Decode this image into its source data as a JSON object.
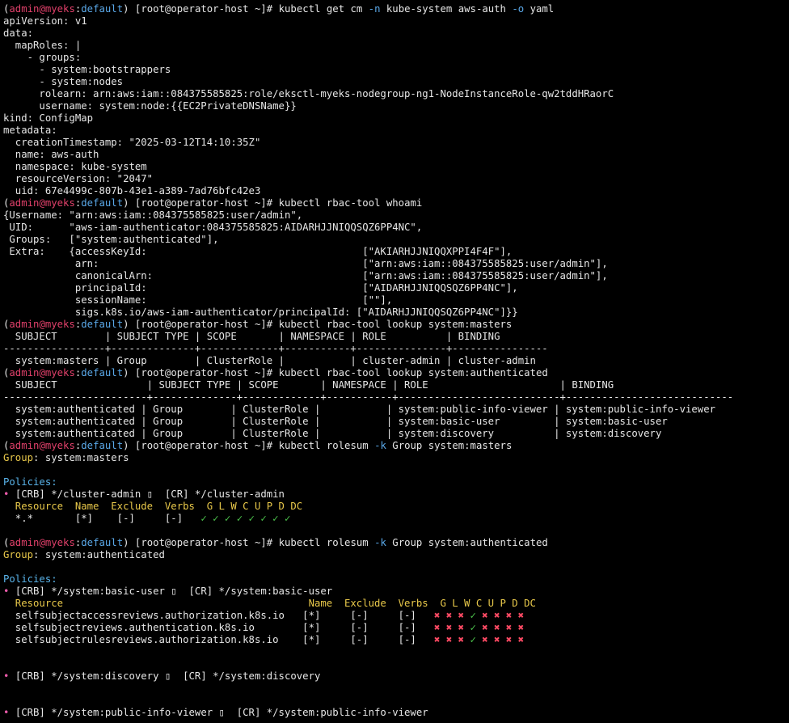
{
  "colors": {
    "background": "#000000",
    "text": "#e6e6e6",
    "prompt_user": "#e0406a",
    "prompt_context": "#5aa8e8",
    "flag": "#5aa8e8",
    "key_label": "#e8c84a",
    "section_title": "#5ab4ea",
    "bullet": "#e85aa8",
    "check": "#4ec94e",
    "cross": "#ff4a64"
  },
  "lines": [
    [
      [
        "p",
        ""
      ]
    ],
    [
      [
        "",
        "apiVersion: v1"
      ]
    ],
    [
      [
        "",
        "data:"
      ]
    ],
    [
      [
        "",
        "  mapRoles: |"
      ]
    ],
    [
      [
        "",
        "    - groups:"
      ]
    ],
    [
      [
        "",
        "      - system:bootstrappers"
      ]
    ],
    [
      [
        "",
        "      - system:nodes"
      ]
    ],
    [
      [
        "",
        "      rolearn: arn:aws:iam::084375585825:role/eksctl-myeks-nodegroup-ng1-NodeInstanceRole-qw2tddHRaorC"
      ]
    ],
    [
      [
        "",
        "      username: system:node:{{EC2PrivateDNSName}}"
      ]
    ],
    [
      [
        "",
        "kind: ConfigMap"
      ]
    ],
    [
      [
        "",
        "metadata:"
      ]
    ],
    [
      [
        "",
        "  creationTimestamp: \"2025-03-12T14:10:35Z\""
      ]
    ],
    [
      [
        "",
        "  name: aws-auth"
      ]
    ],
    [
      [
        "",
        "  namespace: kube-system"
      ]
    ],
    [
      [
        "",
        "  resourceVersion: \"2047\""
      ]
    ],
    [
      [
        "",
        "  uid: 67e4499c-807b-43e1-a389-7ad76bfc42e3"
      ]
    ],
    [
      [
        "p",
        ""
      ]
    ],
    [
      [
        "",
        "{Username: \"arn:aws:iam::084375585825:user/admin\","
      ]
    ],
    [
      [
        "",
        "",
        " UID:      \"aws-iam-authenticator:084375585825:AIDARHJJNIQQSQZ6PP4NC\","
      ]
    ],
    [
      [
        "",
        "",
        " Groups:   [\"system:authenticated\"],"
      ]
    ],
    [
      [
        "",
        "",
        " Extra:    {accessKeyId:                                    [\"AKIARHJJNIQQXPPI4F4F\"],"
      ]
    ],
    [
      [
        "",
        "            arn:                                            [\"arn:aws:iam::084375585825:user/admin\"],"
      ]
    ],
    [
      [
        "",
        "            canonicalArn:                                   [\"arn:aws:iam::084375585825:user/admin\"],"
      ]
    ],
    [
      [
        "",
        "            principalId:                                    [\"AIDARHJJNIQQSQZ6PP4NC\"],"
      ]
    ],
    [
      [
        "",
        "            sessionName:                                    [\"\"],"
      ]
    ],
    [
      [
        "",
        "            sigs.k8s.io/aws-iam-authenticator/principalId: [\"AIDARHJJNIQQSQZ6PP4NC\"]}}"
      ]
    ],
    [
      [
        "p",
        ""
      ]
    ],
    [
      [
        "",
        "  SUBJECT        | SUBJECT TYPE | SCOPE       | NAMESPACE | ROLE          | BINDING"
      ]
    ],
    [
      [
        "",
        "-----------------+--------------+-------------+-----------+---------------+----------------"
      ]
    ],
    [
      [
        "",
        "  system:masters | Group        | ClusterRole |           | cluster-admin | cluster-admin"
      ]
    ],
    [
      [
        "p",
        ""
      ]
    ],
    [
      [
        "",
        "  SUBJECT               | SUBJECT TYPE | SCOPE       | NAMESPACE | ROLE                      | BINDING"
      ]
    ],
    [
      [
        "",
        "------------------------+--------------+-------------+-----------+---------------------------+----------------------------"
      ]
    ],
    [
      [
        "",
        "  system:authenticated | Group        | ClusterRole |           | system:public-info-viewer | system:public-info-viewer"
      ]
    ],
    [
      [
        "",
        "  system:authenticated | Group        | ClusterRole |           | system:basic-user         | system:basic-user"
      ]
    ],
    [
      [
        "",
        "  system:authenticated | Group        | ClusterRole |           | system:discovery          | system:discovery"
      ]
    ],
    [
      [
        "p",
        ""
      ]
    ],
    [
      [
        "k",
        "Group"
      ],
      [
        "",
        ": system:masters"
      ]
    ],
    [
      [
        "",
        ""
      ]
    ],
    [
      [
        "t",
        "Policies:"
      ]
    ],
    [
      [
        "b",
        "• "
      ],
      [
        "",
        "[CRB] */cluster-admin ▯  [CR] */cluster-admin"
      ]
    ],
    [
      [
        "k",
        "  Resource  Name  Exclude  Verbs  G L W C U P D DC"
      ]
    ],
    [
      [
        "",
        "  *.*       [*]    [-]     [-]   "
      ],
      [
        "g",
        "✓ ✓ ✓ ✓ ✓ ✓ ✓ ✓"
      ]
    ],
    [
      [
        "",
        ""
      ]
    ],
    [
      [
        "p",
        ""
      ]
    ],
    [
      [
        "k",
        "Group"
      ],
      [
        "",
        ": system:authenticated"
      ]
    ],
    [
      [
        "",
        ""
      ]
    ],
    [
      [
        "t",
        "Policies:"
      ]
    ],
    [
      [
        "b",
        "• "
      ],
      [
        "",
        "[CRB] */system:basic-user ▯  [CR] */system:basic-user"
      ]
    ],
    [
      [
        "k",
        "  Resource                                         Name  Exclude  Verbs  G L W C U P D DC"
      ]
    ],
    [
      [
        "",
        "  selfsubjectaccessreviews.authorization.k8s.io   [*]     [-]     [-]   "
      ],
      [
        "r",
        "✖ ✖ ✖ "
      ],
      [
        "g",
        "✓ "
      ],
      [
        "r",
        "✖ ✖ ✖ ✖"
      ]
    ],
    [
      [
        "",
        "  selfsubjectreviews.authentication.k8s.io        [*]     [-]     [-]   "
      ],
      [
        "r",
        "✖ ✖ ✖ "
      ],
      [
        "g",
        "✓ "
      ],
      [
        "r",
        "✖ ✖ ✖ ✖"
      ]
    ],
    [
      [
        "",
        "  selfsubjectrulesreviews.authorization.k8s.io    [*]     [-]     [-]   "
      ],
      [
        "r",
        "✖ ✖ ✖ "
      ],
      [
        "g",
        "✓ "
      ],
      [
        "r",
        "✖ ✖ ✖ ✖"
      ]
    ],
    [
      [
        "",
        ""
      ]
    ],
    [
      [
        "",
        ""
      ]
    ],
    [
      [
        "b",
        "• "
      ],
      [
        "",
        "[CRB] */system:discovery ▯  [CR] */system:discovery"
      ]
    ],
    [
      [
        "",
        ""
      ]
    ],
    [
      [
        "",
        ""
      ]
    ],
    [
      [
        "b",
        "• "
      ],
      [
        "",
        "[CRB] */system:public-info-viewer ▯  [CR] */system:public-info-viewer"
      ]
    ]
  ],
  "prompts": [
    {
      "user": "admin",
      "at": "@",
      "host": "myeks",
      "sep": ":",
      "ctx": "default",
      "rest": ") [root@operator-host ~]# ",
      "cmd": [
        [
          "",
          "kubectl get cm "
        ],
        [
          "f",
          "-n"
        ],
        [
          "",
          " kube-system aws-auth "
        ],
        [
          "f",
          "-o"
        ],
        [
          "",
          " yaml"
        ]
      ]
    },
    {
      "user": "admin",
      "at": "@",
      "host": "myeks",
      "sep": ":",
      "ctx": "default",
      "rest": ") [root@operator-host ~]# ",
      "cmd": [
        [
          "",
          "kubectl rbac-tool whoami"
        ]
      ]
    },
    {
      "user": "admin",
      "at": "@",
      "host": "myeks",
      "sep": ":",
      "ctx": "default",
      "rest": ") [root@operator-host ~]# ",
      "cmd": [
        [
          "",
          "kubectl rbac-tool lookup system:masters"
        ]
      ]
    },
    {
      "user": "admin",
      "at": "@",
      "host": "myeks",
      "sep": ":",
      "ctx": "default",
      "rest": ") [root@operator-host ~]# ",
      "cmd": [
        [
          "",
          "kubectl rbac-tool lookup system:authenticated"
        ]
      ]
    },
    {
      "user": "admin",
      "at": "@",
      "host": "myeks",
      "sep": ":",
      "ctx": "default",
      "rest": ") [root@operator-host ~]# ",
      "cmd": [
        [
          "",
          "kubectl rolesum "
        ],
        [
          "f",
          "-k"
        ],
        [
          "",
          " Group system:masters"
        ]
      ]
    },
    {
      "user": "admin",
      "at": "@",
      "host": "myeks",
      "sep": ":",
      "ctx": "default",
      "rest": ") [root@operator-host ~]# ",
      "cmd": [
        [
          "",
          "kubectl rolesum "
        ],
        [
          "f",
          "-k"
        ],
        [
          "",
          " Group system:authenticated"
        ]
      ]
    }
  ]
}
